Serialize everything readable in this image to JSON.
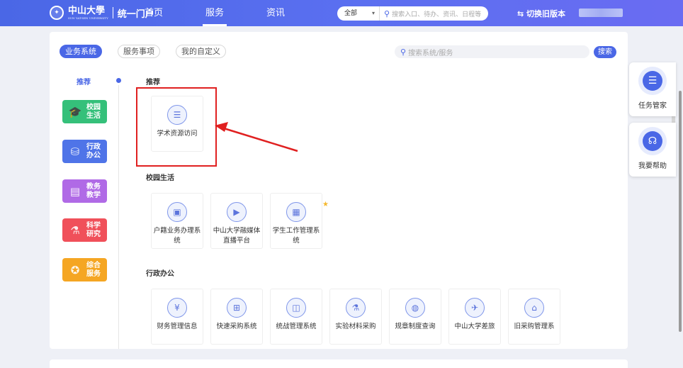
{
  "header": {
    "logo_text": "中山大學",
    "logo_sub": "SUN YAT-SEN UNIVERSITY",
    "portal_label": "统一门户",
    "nav": [
      {
        "label": "首页"
      },
      {
        "label": "服务"
      },
      {
        "label": "资讯"
      }
    ],
    "active_nav": "服务",
    "search_scope": "全部",
    "search_placeholder": "搜索入口、待办、资讯、日程等",
    "switch_label": "⇆ 切换旧版本"
  },
  "tabs": [
    {
      "label": "业务系统",
      "active": true
    },
    {
      "label": "服务事项",
      "active": false
    },
    {
      "label": "我的自定义",
      "active": false
    }
  ],
  "system_search": {
    "placeholder": "搜索系统/服务",
    "button_label": "搜索"
  },
  "rail": {
    "recommend_label": "推荐",
    "categories": [
      {
        "label": "校园生活",
        "color": "#35c07a",
        "icon": "graduation-cap-icon"
      },
      {
        "label": "行政办公",
        "color": "#4f74e8",
        "icon": "stamp-icon"
      },
      {
        "label": "教务教学",
        "color": "#b06ae6",
        "icon": "book-icon"
      },
      {
        "label": "科学研究",
        "color": "#f0505a",
        "icon": "flask-icon"
      },
      {
        "label": "综合服务",
        "color": "#f5a623",
        "icon": "life-ring-icon"
      }
    ]
  },
  "sections": [
    {
      "title": "推荐",
      "items": [
        {
          "label": "学术资源访问",
          "icon": "document-check-icon"
        }
      ]
    },
    {
      "title": "校园生活",
      "items": [
        {
          "label": "户籍业务办理系统",
          "icon": "id-card-icon"
        },
        {
          "label": "中山大学融媒体直播平台",
          "icon": "video-icon"
        },
        {
          "label": "学生工作管理系统",
          "icon": "clipboard-user-icon",
          "starred": true
        }
      ]
    },
    {
      "title": "行政办公",
      "items": [
        {
          "label": "财务管理信息",
          "icon": "yuan-icon"
        },
        {
          "label": "快速采购系统",
          "icon": "cart-icon"
        },
        {
          "label": "统战管理系统",
          "icon": "book-open-icon"
        },
        {
          "label": "实验材料采购",
          "icon": "flask-icon"
        },
        {
          "label": "规章制度查询",
          "icon": "globe-icon"
        },
        {
          "label": "中山大学差旅",
          "icon": "plane-icon"
        },
        {
          "label": "旧采购管理系",
          "icon": "store-icon"
        }
      ]
    }
  ],
  "floating": [
    {
      "label": "任务管家",
      "icon": "chat-list-icon"
    },
    {
      "label": "我要帮助",
      "icon": "headset-icon"
    }
  ],
  "colors": {
    "brand": "#4a67e6",
    "highlight_box": "#e02020",
    "star": "#f5b82e"
  }
}
